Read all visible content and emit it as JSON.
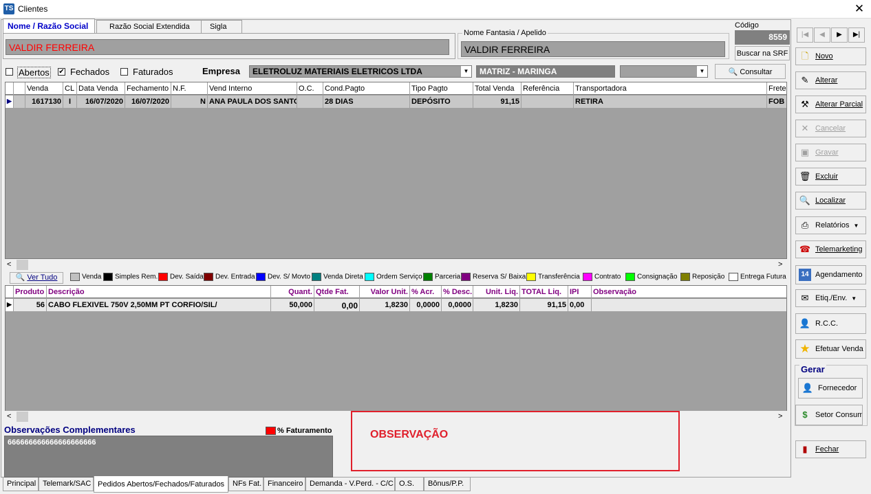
{
  "window": {
    "title": "Clientes",
    "app_icon": "TS"
  },
  "top_tabs": [
    "Nome / Razão Social",
    "Razão Social Extendida",
    "Sigla"
  ],
  "razao_social": "VALDIR FERREIRA",
  "nome_fantasia": {
    "label": "Nome Fantasia / Apelido",
    "value": "VALDIR FERREIRA"
  },
  "codigo": {
    "label": "Código",
    "value": "8559"
  },
  "buscar_srf": "Buscar na SRF",
  "filters": {
    "abertos": "Abertos",
    "fechados": "Fechados",
    "faturados": "Faturados",
    "fechados_checked": true
  },
  "empresa": {
    "label": "Empresa",
    "value": "ELETROLUZ MATERIAIS ELETRICOS LTDA",
    "filial": "MATRIZ - MARINGA"
  },
  "consultar": "Consultar",
  "orders": {
    "columns": [
      "Venda",
      "CL",
      "Data Venda",
      "Fechamento",
      "N.F.",
      "Vend Interno",
      "O.C.",
      "Cond.Pagto",
      "Tipo Pagto",
      "Total Venda",
      "Referência",
      "Transportadora",
      "Frete"
    ],
    "rows": [
      {
        "venda": "1617130",
        "cl": "I",
        "data_venda": "16/07/2020",
        "fechamento": "16/07/2020",
        "nf": "N",
        "vend_interno": "ANA PAULA DOS SANTOS",
        "oc": "",
        "cond_pagto": "28 DIAS",
        "tipo_pagto": "DEPÓSITO",
        "total_venda": "91,15",
        "referencia": "",
        "transportadora": "RETIRA",
        "frete": "FOB"
      }
    ]
  },
  "ver_tudo": "Ver Tudo",
  "legend": [
    {
      "label": "Venda",
      "color": "#c0c0c0"
    },
    {
      "label": "Simples Rem.",
      "color": "#000000"
    },
    {
      "label": "Dev. Saída",
      "color": "#ff0000"
    },
    {
      "label": "Dev. Entrada",
      "color": "#800000"
    },
    {
      "label": "Dev. S/ Movto",
      "color": "#0000ff"
    },
    {
      "label": "Venda Direta",
      "color": "#008080"
    },
    {
      "label": "Ordem Serviço",
      "color": "#00ffff"
    },
    {
      "label": "Parceria",
      "color": "#008000"
    },
    {
      "label": "Reserva S/ Baixa",
      "color": "#800080"
    },
    {
      "label": "Transferência",
      "color": "#ffff00"
    },
    {
      "label": "Contrato",
      "color": "#ff00ff"
    },
    {
      "label": "Consignação",
      "color": "#00ff00"
    },
    {
      "label": "Reposição",
      "color": "#808000"
    },
    {
      "label": "Entrega Futura",
      "color": "#ffffff"
    }
  ],
  "items": {
    "columns": [
      "Produto",
      "Descrição",
      "Quant.",
      "Qtde Fat.",
      "Valor Unit.",
      "% Acr.",
      "% Desc.",
      "Unit. Liq.",
      "TOTAL Liq.",
      "IPI",
      "Observação"
    ],
    "rows": [
      {
        "produto": "56",
        "descricao": "CABO FLEXIVEL 750V 2,50MM PT CORFIO/SIL/",
        "quant": "50,000",
        "qtde_fat": "0,00",
        "valor_unit": "1,8230",
        "acr": "0,0000",
        "desc": "0,0000",
        "unit_liq": "1,8230",
        "total_liq": "91,15",
        "ipi": "0,00",
        "observacao": ""
      }
    ]
  },
  "obs": {
    "title": "Observações Complementares",
    "value": "666666666666666666666",
    "faturamento": "% Faturamento"
  },
  "annotation": "OBSERVAÇÃO",
  "bottom_tabs": [
    "Principal",
    "Telemark/SAC",
    "Pedidos Abertos/Fechados/Faturados",
    "NFs Fat.",
    "Financeiro",
    "Demanda - V.Perd. - C/C",
    "O.S.",
    "Bônus/P.P."
  ],
  "actions": {
    "novo": "Novo",
    "alterar": "Alterar",
    "alterar_parcial": "Alterar Parcial",
    "cancelar": "Cancelar",
    "gravar": "Gravar",
    "excluir": "Excluir",
    "localizar": "Localizar",
    "relatorios": "Relatórios",
    "telemarketing": "Telemarketing",
    "agendamento": "Agendamento",
    "etiq": "Etiq./Env.",
    "rcc": "R.C.C.",
    "efetuar_venda": "Efetuar Venda",
    "gerar": "Gerar",
    "fornecedor": "Fornecedor",
    "setor_consumidor": "Setor Consumid",
    "fechar": "Fechar"
  }
}
